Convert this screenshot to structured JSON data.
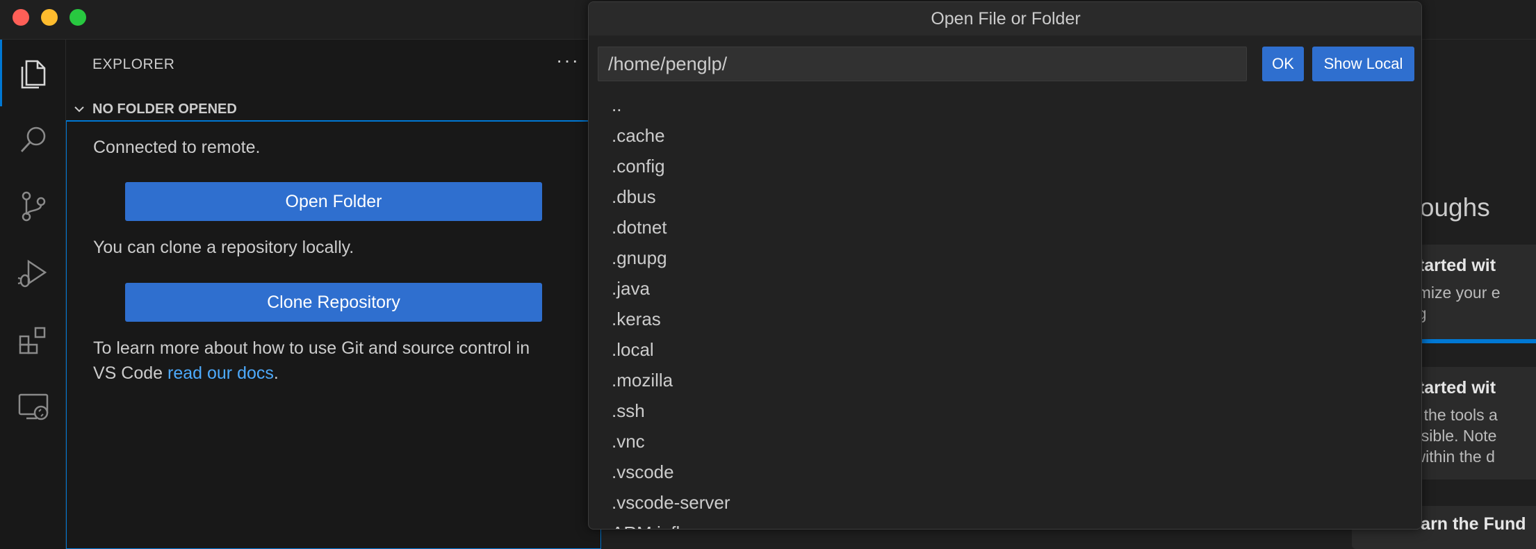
{
  "window": {
    "controls": [
      "close",
      "minimize",
      "maximize"
    ]
  },
  "activity_bar": {
    "items": [
      {
        "icon": "files-icon",
        "active": true
      },
      {
        "icon": "search-icon",
        "active": false
      },
      {
        "icon": "source-control-icon",
        "active": false
      },
      {
        "icon": "run-debug-icon",
        "active": false
      },
      {
        "icon": "extensions-icon",
        "active": false
      },
      {
        "icon": "remote-explorer-icon",
        "active": false
      }
    ]
  },
  "sidebar": {
    "header": "EXPLORER",
    "more": "···",
    "section_title": "NO FOLDER OPENED",
    "connected_text": "Connected to remote.",
    "open_folder_label": "Open Folder",
    "clone_text": "You can clone a repository locally.",
    "clone_label": "Clone Repository",
    "learn_text_1": "To learn more about how to use Git and source control in",
    "learn_text_2": "VS Code ",
    "learn_link": "read our docs",
    "learn_text_3": "."
  },
  "editor": {
    "walkthroughs_title": "hroughs",
    "cards": [
      {
        "title": "t Started wit",
        "desc": [
          "stomize your e",
          "ding"
        ]
      },
      {
        "title": "t Started wit",
        "desc": [
          "arn the tools a",
          "cessible. Note",
          "m within the d"
        ]
      },
      {
        "title": "Learn the Fund",
        "desc": []
      }
    ]
  },
  "dialog": {
    "title": "Open File or Folder",
    "path_value": "/home/penglp/",
    "ok_label": "OK",
    "show_local_label": "Show Local",
    "items": [
      "..",
      ".cache",
      ".config",
      ".dbus",
      ".dotnet",
      ".gnupg",
      ".java",
      ".keras",
      ".local",
      ".mozilla",
      ".ssh",
      ".vnc",
      ".vscode",
      ".vscode-server",
      "ARM influenza"
    ]
  },
  "colors": {
    "accent": "#0078d4",
    "button": "#2f6fcf",
    "link": "#4daafc"
  }
}
